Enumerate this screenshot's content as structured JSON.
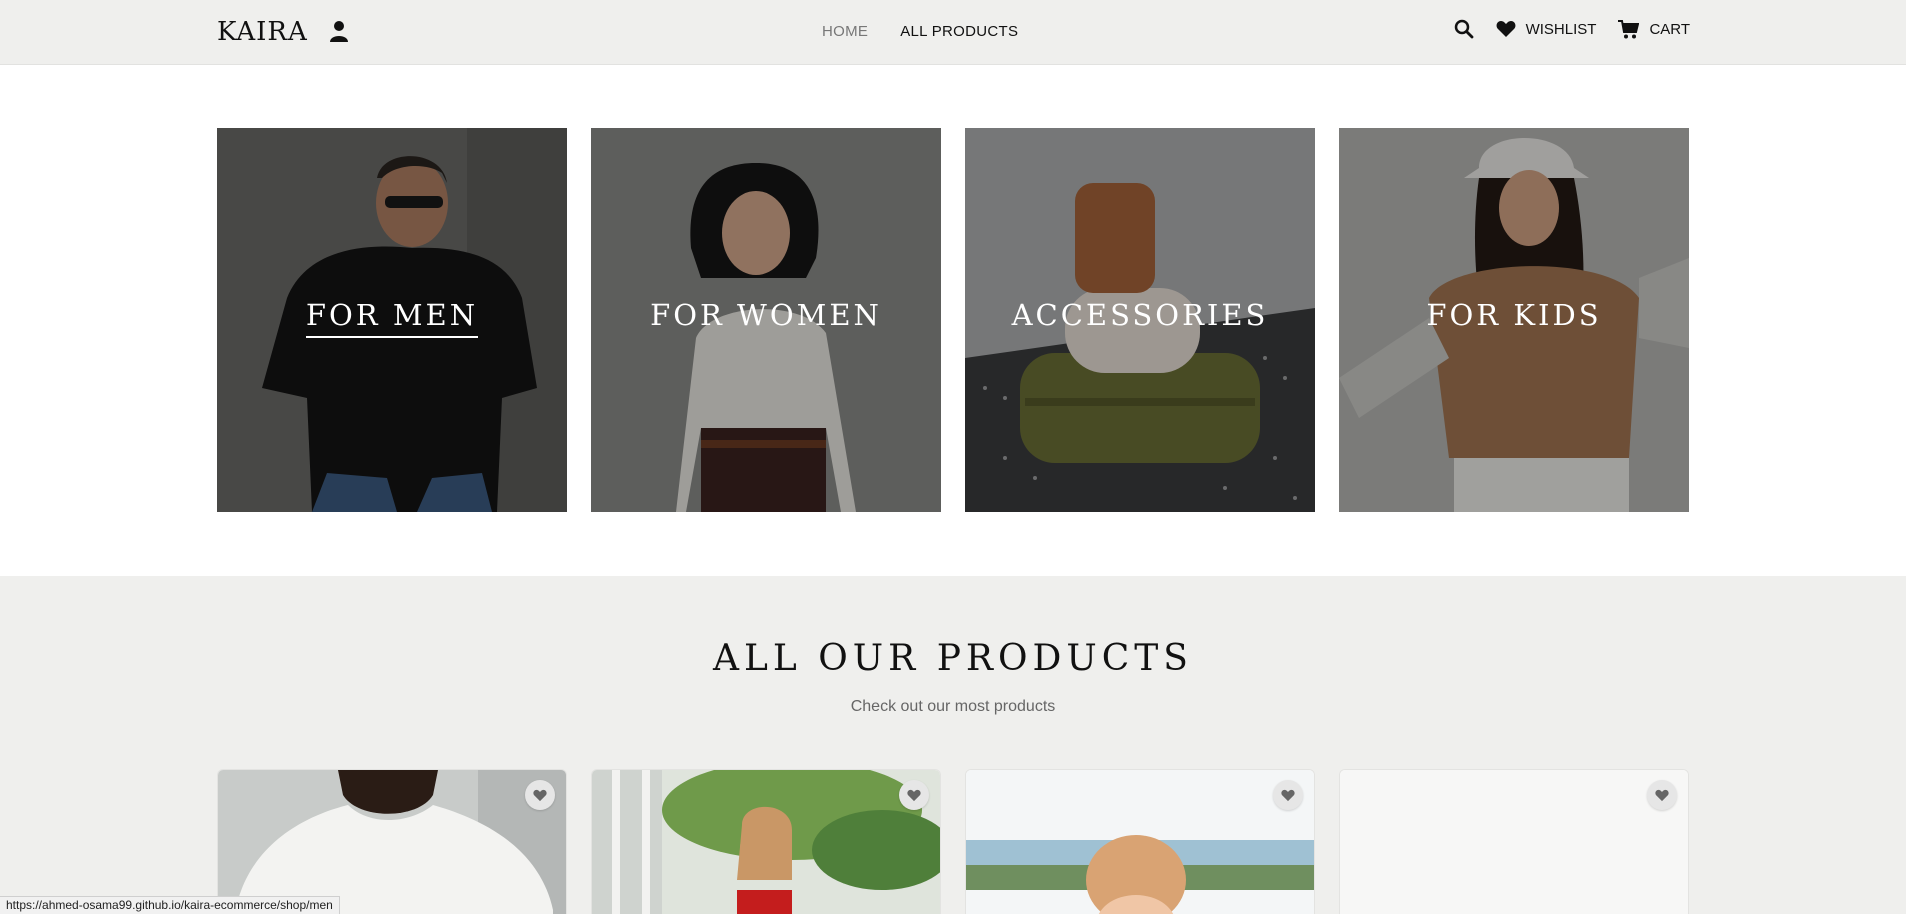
{
  "header": {
    "logo": "KAIRA",
    "nav": [
      {
        "label": "HOME"
      },
      {
        "label": "ALL PRODUCTS"
      }
    ],
    "wishlist_label": "WISHLIST",
    "cart_label": "CART",
    "icons": [
      "user-icon",
      "search-icon",
      "heart-icon",
      "cart-icon"
    ]
  },
  "categories": [
    {
      "label": "FOR MEN"
    },
    {
      "label": "FOR WOMEN"
    },
    {
      "label": "ACCESSORIES"
    },
    {
      "label": "FOR KIDS"
    }
  ],
  "products": {
    "title": "ALL OUR PRODUCTS",
    "subtitle": "Check out our most products"
  },
  "status_url": "https://ahmed-osama99.github.io/kaira-ecommerce/shop/men",
  "colors": {
    "header_bg": "#efefed",
    "section_bg": "#efefed",
    "accent": "#111111"
  }
}
